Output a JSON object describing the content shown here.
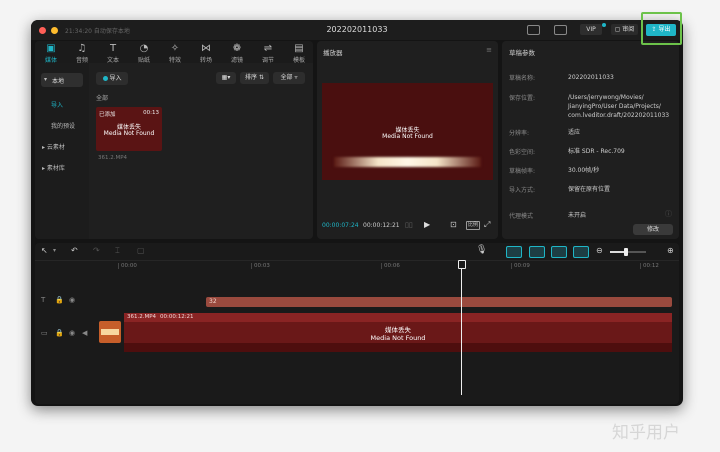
{
  "window": {
    "title": "202202011033",
    "autosave": "21:34:20 自动保存本地",
    "review_label": "审阅",
    "export_label": "导出",
    "vip_label": "VIP"
  },
  "media_toolbar": {
    "tools": [
      {
        "label": "媒体",
        "icon": "media-icon",
        "glyph": "▣"
      },
      {
        "label": "音频",
        "icon": "audio-icon",
        "glyph": "♫"
      },
      {
        "label": "文本",
        "icon": "text-icon",
        "glyph": "T"
      },
      {
        "label": "贴纸",
        "icon": "sticker-icon",
        "glyph": "◔"
      },
      {
        "label": "特效",
        "icon": "effects-icon",
        "glyph": "✧"
      },
      {
        "label": "转场",
        "icon": "transition-icon",
        "glyph": "⋈"
      },
      {
        "label": "滤镜",
        "icon": "filter-icon",
        "glyph": "❁"
      },
      {
        "label": "调节",
        "icon": "adjust-icon",
        "glyph": "⇌"
      },
      {
        "label": "模板",
        "icon": "template-icon",
        "glyph": "▤"
      }
    ]
  },
  "media_sidebar": {
    "local": "本地",
    "import": "导入",
    "presets": "我的预设",
    "cloud": "云素材",
    "library": "素材库"
  },
  "media_main": {
    "import_button": "导入",
    "sort_label": "排序",
    "filter_label": "全部",
    "all_label": "全部",
    "item": {
      "added_badge": "已添加",
      "duration": "00:13",
      "missing_zh": "媒体丢失",
      "missing_en": "Media Not Found",
      "filename": "361.2.MP4"
    }
  },
  "player": {
    "title": "播放器",
    "current_time": "00:00:07:24",
    "total_time": "00:00:12:21",
    "missing_zh": "媒体丢失",
    "missing_en": "Media Not Found",
    "ratio_label": "比例"
  },
  "draft": {
    "title": "草稿参数",
    "rows": [
      {
        "key": "草稿名称:",
        "value": "202202011033"
      },
      {
        "key": "保存位置:",
        "value": "/Users/jerrywong/Movies/ JianyingPro/User Data/Projects/ com.lveditor.draft/202202011033"
      },
      {
        "key": "分辨率:",
        "value": "适应"
      },
      {
        "key": "色彩空间:",
        "value": "标准 SDR - Rec.709"
      },
      {
        "key": "草稿帧率:",
        "value": "30.00帧/秒"
      },
      {
        "key": "导入方式:",
        "value": "保留在原有位置"
      },
      {
        "key": "代理模式",
        "value": "未开启"
      }
    ],
    "edit_button": "修改"
  },
  "timeline": {
    "ruler": [
      "00:00",
      "00:03",
      "00:06",
      "00:09",
      "00:12"
    ],
    "text_clip_label": "32",
    "video_clip": {
      "filename": "361.2.MP4",
      "duration": "00:00:12:21",
      "missing_zh": "媒体丢失",
      "missing_en": "Media Not Found"
    }
  },
  "watermark": "知乎用户",
  "colors": {
    "accent": "#1fb6c7",
    "highlight_box": "#6cc24a",
    "clip_red": "#7c1f20",
    "text_clip": "#9a4a3e"
  }
}
